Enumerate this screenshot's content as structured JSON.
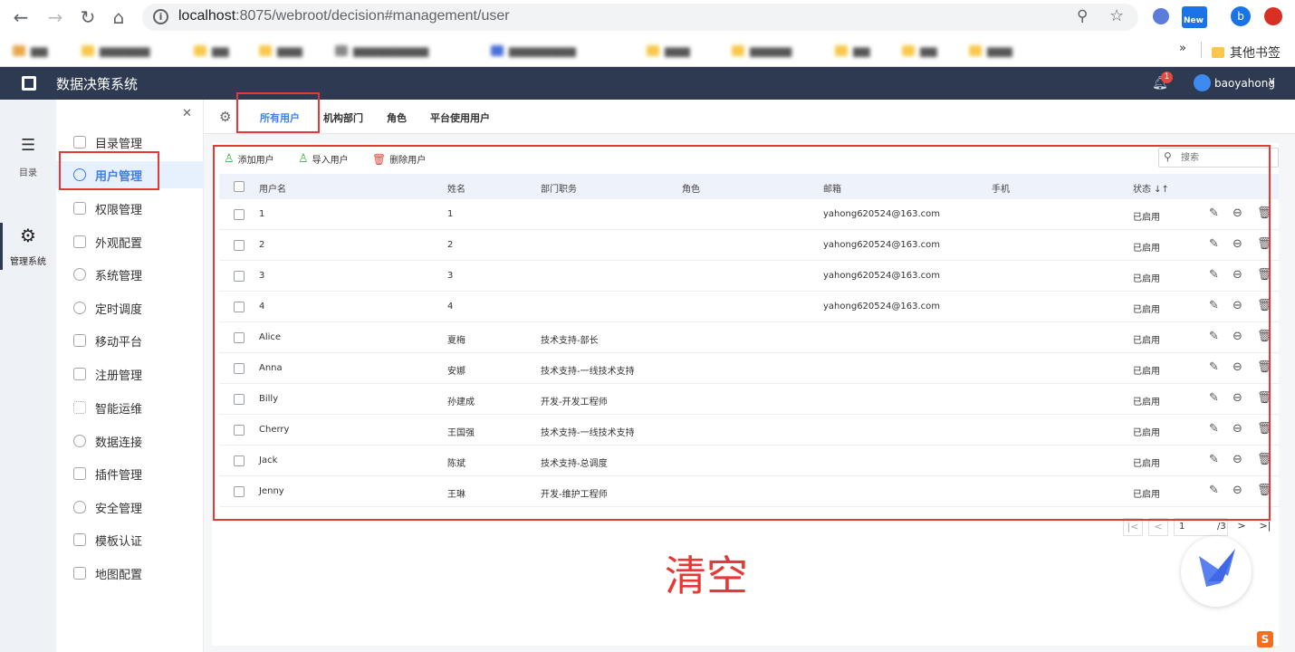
{
  "browser": {
    "url_host": "localhost",
    "url_rest": ":8075/webroot/decision#management/user",
    "ext_new_label": "New",
    "profile_letter": "b",
    "bookmarks_more": "»",
    "other_bookmarks": "其他书签"
  },
  "header": {
    "title": "数据决策系统",
    "notification_count": "1",
    "username": "baoyahong"
  },
  "rail": {
    "catalog_label": "目录",
    "system_label": "管理系统"
  },
  "menu": {
    "items": [
      {
        "label": "目录管理"
      },
      {
        "label": "用户管理"
      },
      {
        "label": "权限管理"
      },
      {
        "label": "外观配置"
      },
      {
        "label": "系统管理"
      },
      {
        "label": "定时调度"
      },
      {
        "label": "移动平台"
      },
      {
        "label": "注册管理"
      },
      {
        "label": "智能运维"
      },
      {
        "label": "数据连接"
      },
      {
        "label": "插件管理"
      },
      {
        "label": "安全管理"
      },
      {
        "label": "模板认证"
      },
      {
        "label": "地图配置"
      }
    ]
  },
  "tabs": [
    {
      "label": "所有用户"
    },
    {
      "label": "机构部门"
    },
    {
      "label": "角色"
    },
    {
      "label": "平台使用用户"
    }
  ],
  "toolbar": {
    "add_user": "添加用户",
    "import_user": "导入用户",
    "delete_user": "删除用户",
    "search_placeholder": "搜索"
  },
  "table": {
    "columns": {
      "username": "用户名",
      "name": "姓名",
      "dept": "部门职务",
      "role": "角色",
      "email": "邮箱",
      "phone": "手机",
      "status": "状态 ↓↑"
    },
    "rows": [
      {
        "username": "1",
        "name": "1",
        "dept": "",
        "role": "",
        "email": "yahong620524@163.com",
        "phone": "",
        "status": "已启用"
      },
      {
        "username": "2",
        "name": "2",
        "dept": "",
        "role": "",
        "email": "yahong620524@163.com",
        "phone": "",
        "status": "已启用"
      },
      {
        "username": "3",
        "name": "3",
        "dept": "",
        "role": "",
        "email": "yahong620524@163.com",
        "phone": "",
        "status": "已启用"
      },
      {
        "username": "4",
        "name": "4",
        "dept": "",
        "role": "",
        "email": "yahong620524@163.com",
        "phone": "",
        "status": "已启用"
      },
      {
        "username": "Alice",
        "name": "夏梅",
        "dept": "技术支持-部长",
        "role": "",
        "email": "",
        "phone": "",
        "status": "已启用"
      },
      {
        "username": "Anna",
        "name": "安娜",
        "dept": "技术支持-一线技术支持",
        "role": "",
        "email": "",
        "phone": "",
        "status": "已启用"
      },
      {
        "username": "Billy",
        "name": "孙建成",
        "dept": "开发-开发工程师",
        "role": "",
        "email": "",
        "phone": "",
        "status": "已启用"
      },
      {
        "username": "Cherry",
        "name": "王国强",
        "dept": "技术支持-一线技术支持",
        "role": "",
        "email": "",
        "phone": "",
        "status": "已启用"
      },
      {
        "username": "Jack",
        "name": "陈斌",
        "dept": "技术支持-总调度",
        "role": "",
        "email": "",
        "phone": "",
        "status": "已启用"
      },
      {
        "username": "Jenny",
        "name": "王琳",
        "dept": "开发-维护工程师",
        "role": "",
        "email": "",
        "phone": "",
        "status": "已启用"
      }
    ]
  },
  "pager": {
    "current": "1",
    "total": "/3"
  },
  "annotation": {
    "clear_text": "清空"
  },
  "colors": {
    "header_bg": "#2d3a52",
    "accent": "#3d7ff1",
    "annotation_red": "#e53935"
  }
}
